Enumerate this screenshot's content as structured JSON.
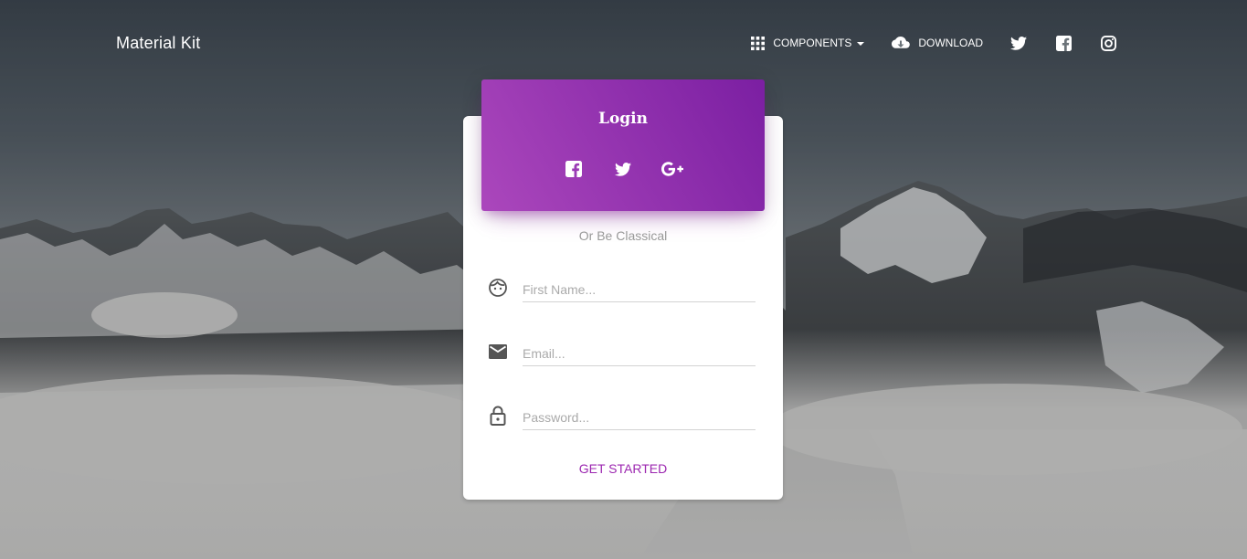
{
  "navbar": {
    "brand": "Material Kit",
    "components_label": "Components",
    "download_label": "Download",
    "social_icons": [
      "twitter-icon",
      "facebook-icon",
      "instagram-icon"
    ]
  },
  "login_card": {
    "title": "Login",
    "social_buttons": [
      "facebook-icon",
      "twitter-icon",
      "google-plus-icon"
    ],
    "subtitle": "Or Be Classical",
    "fields": {
      "first_name_placeholder": "First Name...",
      "email_placeholder": "Email...",
      "password_placeholder": "Password..."
    },
    "submit_label": "Get Started"
  },
  "colors": {
    "primary": "#9c27b0",
    "header_gradient_start": "#ab47bc",
    "header_gradient_end": "#7b1fa2",
    "card_background": "#ffffff"
  }
}
